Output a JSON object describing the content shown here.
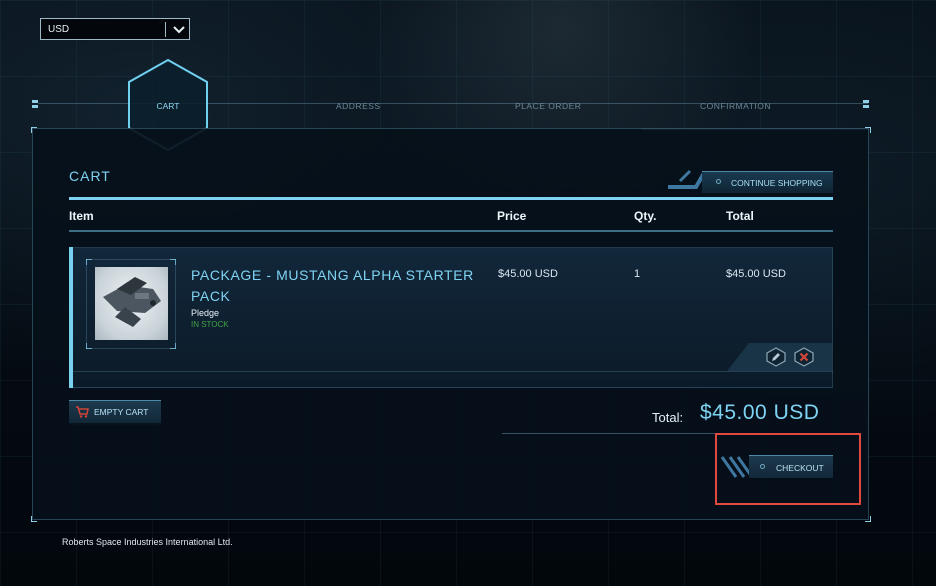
{
  "currency": {
    "selected": "USD"
  },
  "steps": [
    {
      "label": "CART",
      "active": true
    },
    {
      "label": "ADDRESS",
      "active": false
    },
    {
      "label": "PLACE ORDER",
      "active": false
    },
    {
      "label": "CONFIRMATION",
      "active": false
    }
  ],
  "cart": {
    "title": "CART",
    "continue_label": "CONTINUE SHOPPING",
    "columns": {
      "item": "Item",
      "price": "Price",
      "qty": "Qty.",
      "total": "Total"
    },
    "items": [
      {
        "name": "PACKAGE - MUSTANG ALPHA STARTER PACK",
        "type": "Pledge",
        "stock": "IN STOCK",
        "price": "$45.00 USD",
        "qty": "1",
        "total": "$45.00 USD",
        "thumb_icon": "ship-image"
      }
    ],
    "empty_label": "EMPTY CART",
    "total_label": "Total:",
    "total_value": "$45.00 USD",
    "checkout_label": "CHECKOUT"
  },
  "footer": {
    "text": "Roberts Space Industries International Ltd."
  },
  "colors": {
    "accent": "#7fd3f2",
    "stock": "#3fa244",
    "highlight": "#e04a3f",
    "danger": "#d0463a"
  }
}
